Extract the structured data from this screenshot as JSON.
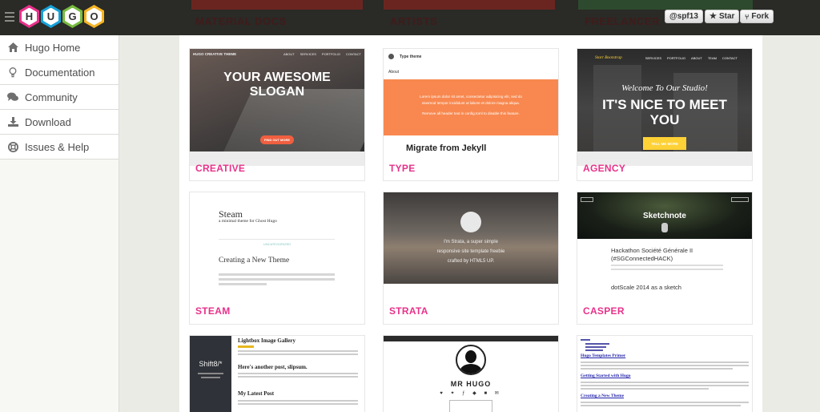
{
  "header": {
    "brand_letters": [
      "H",
      "U",
      "G",
      "O"
    ],
    "brand_colors": [
      "#e8318a",
      "#16a1d8",
      "#76bc3e",
      "#f6b426"
    ],
    "behind_labels": [
      "MATERIAL DOCS",
      "ARTISTS",
      "FREELANCER"
    ],
    "github_user": "@spf13",
    "star_label": "Star",
    "fork_label": "Fork"
  },
  "sidebar": {
    "items": [
      {
        "label": "Hugo Home",
        "icon": "home-icon"
      },
      {
        "label": "Documentation",
        "icon": "lightbulb-icon"
      },
      {
        "label": "Community",
        "icon": "chat-icon"
      },
      {
        "label": "Download",
        "icon": "download-icon"
      },
      {
        "label": "Issues & Help",
        "icon": "lifebuoy-icon"
      }
    ]
  },
  "themes": {
    "creative": {
      "name": "CREATIVE",
      "brand": "HUGO CREATIVE THEME",
      "nav": [
        "ABOUT",
        "SERVICES",
        "PORTFOLIO",
        "CONTACT"
      ],
      "slogan_1": "YOUR AWESOME",
      "slogan_2": "SLOGAN",
      "cta": "FIND OUT MORE"
    },
    "type": {
      "name": "TYPE",
      "site_title": "Type theme",
      "about": "About",
      "banner_1": "Lorem ipsum dolor sit amet, consectetur adipisicing elit, sed do",
      "banner_2": "eiusmod tempor incididunt ut labore et dolore magna aliqua.",
      "banner_3": "Remove all header text in config.toml to disable this feature.",
      "post_title": "Migrate from Jekyll"
    },
    "agency": {
      "name": "AGENCY",
      "brand": "Start Bootstrap",
      "nav": [
        "SERVICES",
        "PORTFOLIO",
        "ABOUT",
        "TEAM",
        "CONTACT"
      ],
      "welcome": "Welcome To Our Studio!",
      "heading_1": "IT'S NICE TO MEET",
      "heading_2": "YOU",
      "cta": "TELL ME MORE"
    },
    "steam": {
      "name": "STEAM",
      "title": "Steam",
      "subtitle": "a minimal theme for Ghost Hugo",
      "tag": "UNCATEGORIZED",
      "post_title": "Creating a New Theme"
    },
    "strata": {
      "name": "STRATA",
      "line_1": "I'm Strata, a super simple",
      "line_2": "responsive site template freebie",
      "line_3": "crafted by HTML5 UP."
    },
    "casper": {
      "name": "CASPER",
      "site_title": "Sketchnote",
      "post_1": "Hackathon Société Générale II",
      "post_1b": "(#SGConnectedHACK)",
      "post_2": "dotScale 2014 as a sketch"
    },
    "shift": {
      "title": "Shift8/*",
      "post_1": "Lightbox Image Gallery",
      "post_2": "Here's another post, slipsum.",
      "post_3": "My Latest Post"
    },
    "mrhugo": {
      "name": "MR HUGO"
    },
    "plain": {
      "heading": "Hugo Templates Primer",
      "heading_2": "Getting Started with Hugo",
      "heading_3": "Creating a New Theme"
    }
  }
}
